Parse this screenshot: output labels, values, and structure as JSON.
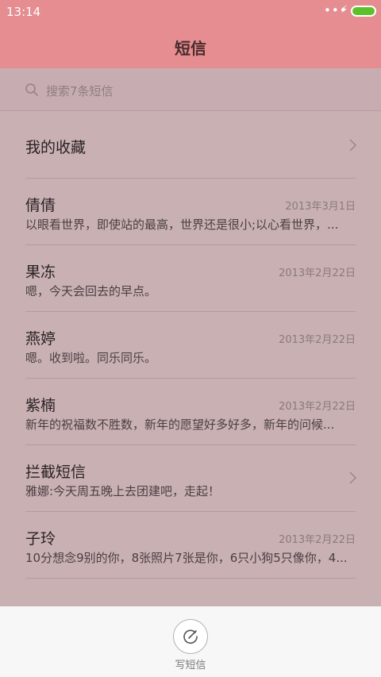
{
  "status": {
    "time": "13:14",
    "dots": "•••",
    "bolt": "⚡"
  },
  "header": {
    "title": "短信"
  },
  "search": {
    "placeholder": "搜索7条短信"
  },
  "favorites": {
    "label": "我的收藏"
  },
  "conversations": [
    {
      "name": "倩倩",
      "date": "2013年3月1日",
      "snippet": "以眼看世界，即使站的最高，世界还是很小;以心看世界，..."
    },
    {
      "name": "果冻",
      "date": "2013年2月22日",
      "snippet": "嗯，今天会回去的早点。"
    },
    {
      "name": "燕婷",
      "date": "2013年2月22日",
      "snippet": "嗯。收到啦。同乐同乐。"
    },
    {
      "name": "紫楠",
      "date": "2013年2月22日",
      "snippet": "新年的祝福数不胜数，新年的愿望好多好多，新年的问候..."
    },
    {
      "name": "拦截短信",
      "date": "",
      "snippet": "雅娜:今天周五晚上去团建吧，走起！"
    },
    {
      "name": "子玲",
      "date": "2013年2月22日",
      "snippet": "10分想念9别的你，8张照片7张是你，6只小狗5只像你，4..."
    }
  ],
  "compose": {
    "label": "写短信"
  },
  "colors": {
    "header": "#e58d90",
    "background": "#c9b0b3",
    "battery": "#5cc22c"
  }
}
